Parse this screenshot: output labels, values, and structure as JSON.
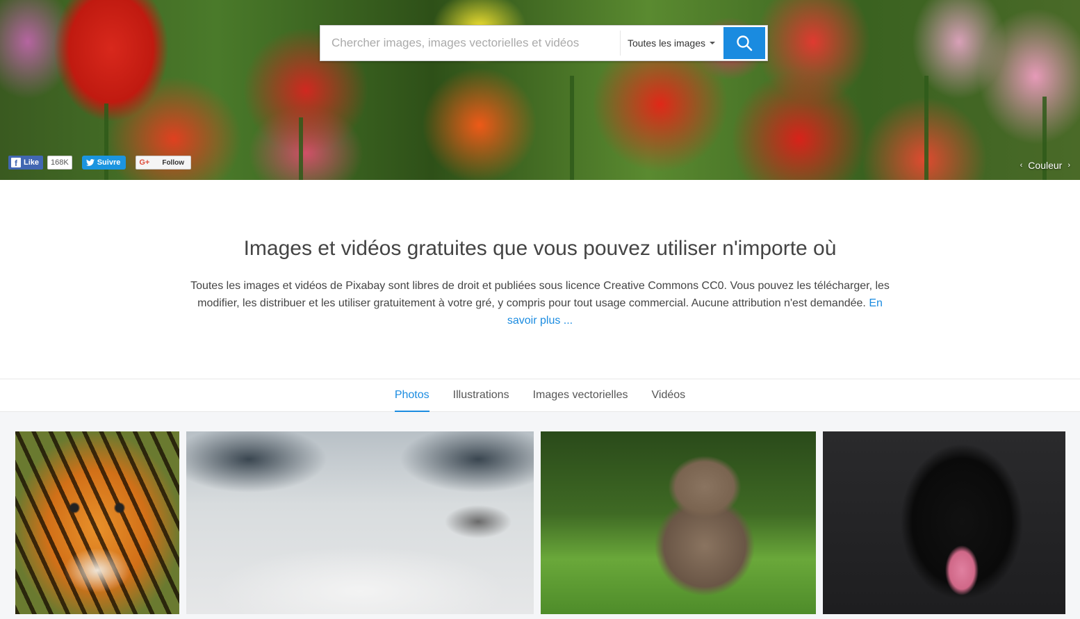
{
  "search": {
    "placeholder": "Chercher images, images vectorielles et vidéos",
    "type_label": "Toutes les images"
  },
  "social": {
    "facebook_label": "Like",
    "facebook_count": "168K",
    "twitter_label": "Suivre",
    "google_label": "Follow"
  },
  "hero": {
    "color_label": "Couleur"
  },
  "intro": {
    "title": "Images et vidéos gratuites que vous pouvez utiliser n'importe où",
    "text": "Toutes les images et vidéos de Pixabay sont libres de droit et publiées sous licence Creative Commons CC0. Vous pouvez les télécharger, les modifier, les distribuer et les utiliser gratuitement à votre gré, y compris pour tout usage commercial. Aucune attribution n'est demandée.",
    "link": "En savoir plus ..."
  },
  "tabs": [
    {
      "label": "Photos",
      "active": true
    },
    {
      "label": "Illustrations",
      "active": false
    },
    {
      "label": "Images vectorielles",
      "active": false
    },
    {
      "label": "Vidéos",
      "active": false
    }
  ],
  "colors": {
    "accent": "#1a8be0",
    "facebook": "#4267b2",
    "twitter": "#1b95e0"
  },
  "icons": {
    "search": "search-icon",
    "facebook": "facebook-icon",
    "twitter": "twitter-icon",
    "google": "google-plus-icon"
  }
}
